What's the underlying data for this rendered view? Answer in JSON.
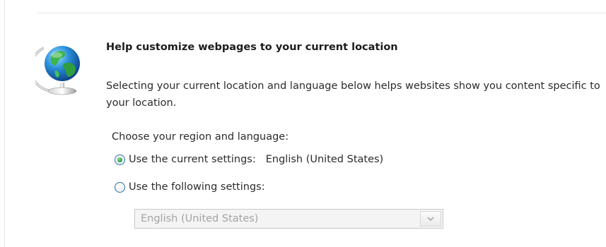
{
  "page": {
    "heading": "Help customize webpages to your current location",
    "description": "Selecting your current location and language below helps websites show you content specific to your location.",
    "choose_label": "Choose your region and language:"
  },
  "region": {
    "options": [
      {
        "label": "Use the current settings:",
        "value": "English (United States)",
        "selected": true
      },
      {
        "label": "Use the following settings:",
        "selected": false
      }
    ],
    "dropdown": {
      "selected": "English (United States)",
      "enabled": false
    }
  },
  "icons": {
    "globe": "globe-icon",
    "dropdown_arrow": "chevron-down-icon"
  },
  "colors": {
    "radio_selected": "#1f9a3c",
    "radio_border": "#2f6e99",
    "disabled_text": "#a3a3a3"
  }
}
